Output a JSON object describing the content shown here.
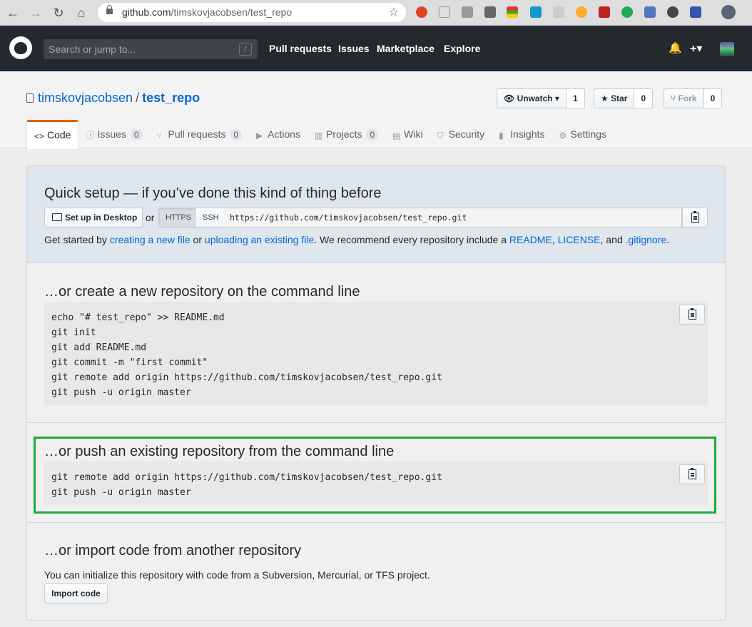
{
  "browser": {
    "url_host": "github.com",
    "url_path": "/timskovjacobsen/test_repo"
  },
  "header": {
    "search_placeholder": "Search or jump to...",
    "search_shortcut": "/",
    "nav": [
      "Pull requests",
      "Issues",
      "Marketplace",
      "Explore"
    ],
    "plus": "+▾",
    "bell": "🔔"
  },
  "repo": {
    "owner": "timskovjacobsen",
    "separator": "/",
    "name": "test_repo",
    "watch_label": "Unwatch ▾",
    "watch_count": "1",
    "star_label": "Star",
    "star_count": "0",
    "fork_label": "Fork",
    "fork_count": "0"
  },
  "tabs": [
    {
      "label": "Code",
      "icon": "<>"
    },
    {
      "label": "Issues",
      "count": "0",
      "icon": "ⓘ"
    },
    {
      "label": "Pull requests",
      "count": "0",
      "icon": "⑂"
    },
    {
      "label": "Actions",
      "icon": "▶"
    },
    {
      "label": "Projects",
      "count": "0",
      "icon": "▥"
    },
    {
      "label": "Wiki",
      "icon": "▤"
    },
    {
      "label": "Security",
      "icon": "⛉"
    },
    {
      "label": "Insights",
      "icon": "▮"
    },
    {
      "label": "Settings",
      "icon": "⚙"
    }
  ],
  "quick_setup": {
    "title": "Quick setup — if you’ve done this kind of thing before",
    "desktop_button": "Set up in Desktop",
    "or": "or",
    "https": "HTTPS",
    "ssh": "SSH",
    "clone_url": "https://github.com/timskovjacobsen/test_repo.git",
    "get_started_1": "Get started by ",
    "link_new_file": "creating a new file",
    "get_started_2": " or ",
    "link_upload": "uploading an existing file",
    "get_started_3": ". We recommend every repository include a ",
    "link_readme": "README",
    "comma": ", ",
    "link_license": "LICENSE",
    "and": ", and ",
    "link_gitignore": ".gitignore",
    "period": "."
  },
  "new_repo": {
    "title": "…or create a new repository on the command line",
    "lines": [
      "echo \"# test_repo\" >> README.md",
      "git init",
      "git add README.md",
      "git commit -m \"first commit\"",
      "git remote add origin https://github.com/timskovjacobsen/test_repo.git",
      "git push -u origin master"
    ]
  },
  "push_existing": {
    "title": "…or push an existing repository from the command line",
    "lines": [
      "git remote add origin https://github.com/timskovjacobsen/test_repo.git",
      "git push -u origin master"
    ]
  },
  "import": {
    "title": "…or import code from another repository",
    "description": "You can initialize this repository with code from a Subversion, Mercurial, or TFS project.",
    "button": "Import code"
  }
}
